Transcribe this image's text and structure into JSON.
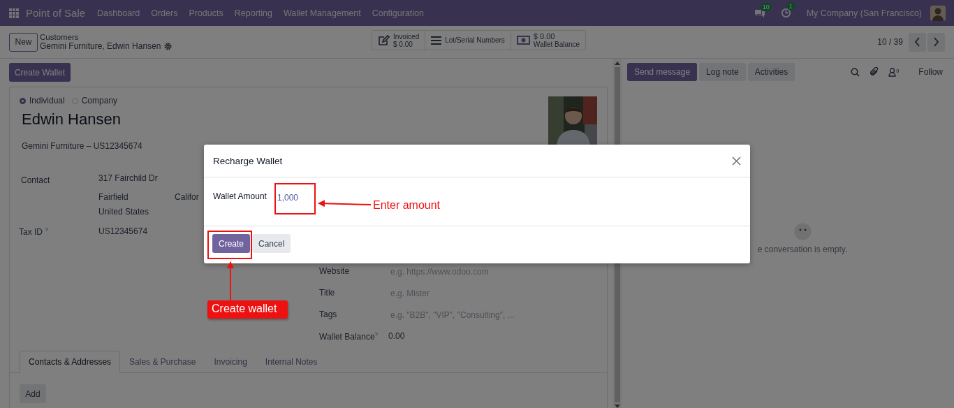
{
  "navbar": {
    "app": "Point of Sale",
    "menu": [
      "Dashboard",
      "Orders",
      "Products",
      "Reporting",
      "Wallet Management",
      "Configuration"
    ],
    "messages_badge": "10",
    "activities_badge": "1",
    "company": "My Company (San Francisco)"
  },
  "control_panel": {
    "new_button": "New",
    "breadcrumb": {
      "parent": "Customers",
      "current": "Gemini Furniture, Edwin Hansen"
    },
    "smart_buttons": [
      {
        "kind": "invoiced",
        "label": "Invoiced",
        "value": "$ 0.00"
      },
      {
        "kind": "lots",
        "label": "Lot/Serial Numbers"
      },
      {
        "kind": "wallet",
        "value": "$ 0.00",
        "label": "Wallet Balance"
      }
    ],
    "pager": "10 / 39"
  },
  "action_button": "Create Wallet",
  "form": {
    "type_options": [
      {
        "label": "Individual",
        "selected": true
      },
      {
        "label": "Company",
        "selected": false
      }
    ],
    "name": "Edwin Hansen",
    "company_line": "Gemini Furniture – US12345674",
    "contact_label": "Contact",
    "address": {
      "street": "317 Fairchild Dr",
      "city": "Fairfield",
      "state": "Califor",
      "country": "United States"
    },
    "tax_id": {
      "label": "Tax ID",
      "help": "?",
      "value": "US12345674"
    },
    "right_fields": [
      {
        "label": "Website",
        "placeholder": "e.g. https://www.odoo.com"
      },
      {
        "label": "Title",
        "placeholder": "e.g. Mister"
      },
      {
        "label": "Tags",
        "placeholder": "e.g. \"B2B\", \"VIP\", \"Consulting\", ..."
      },
      {
        "label": "Wallet Balance",
        "help": "?",
        "value": "0.00"
      }
    ],
    "tabs": [
      {
        "label": "Contacts & Addresses",
        "selected": true
      },
      {
        "label": "Sales & Purchase",
        "selected": false
      },
      {
        "label": "Invoicing",
        "selected": false
      },
      {
        "label": "Internal Notes",
        "selected": false
      }
    ],
    "add_button": "Add"
  },
  "chatter": {
    "buttons": [
      {
        "label": "Send message",
        "primary": true
      },
      {
        "label": "Log note",
        "primary": false
      },
      {
        "label": "Activities",
        "primary": false
      }
    ],
    "followers_count": "0",
    "follow": "Follow",
    "empty_text": "e conversation is empty."
  },
  "dialog": {
    "title": "Recharge Wallet",
    "field_label": "Wallet Amount",
    "value": "1,000",
    "buttons": [
      {
        "label": "Create",
        "primary": true
      },
      {
        "label": "Cancel",
        "primary": false
      }
    ]
  },
  "annotations": [
    {
      "text": "Enter amount"
    },
    {
      "text": "Create wallet"
    }
  ]
}
